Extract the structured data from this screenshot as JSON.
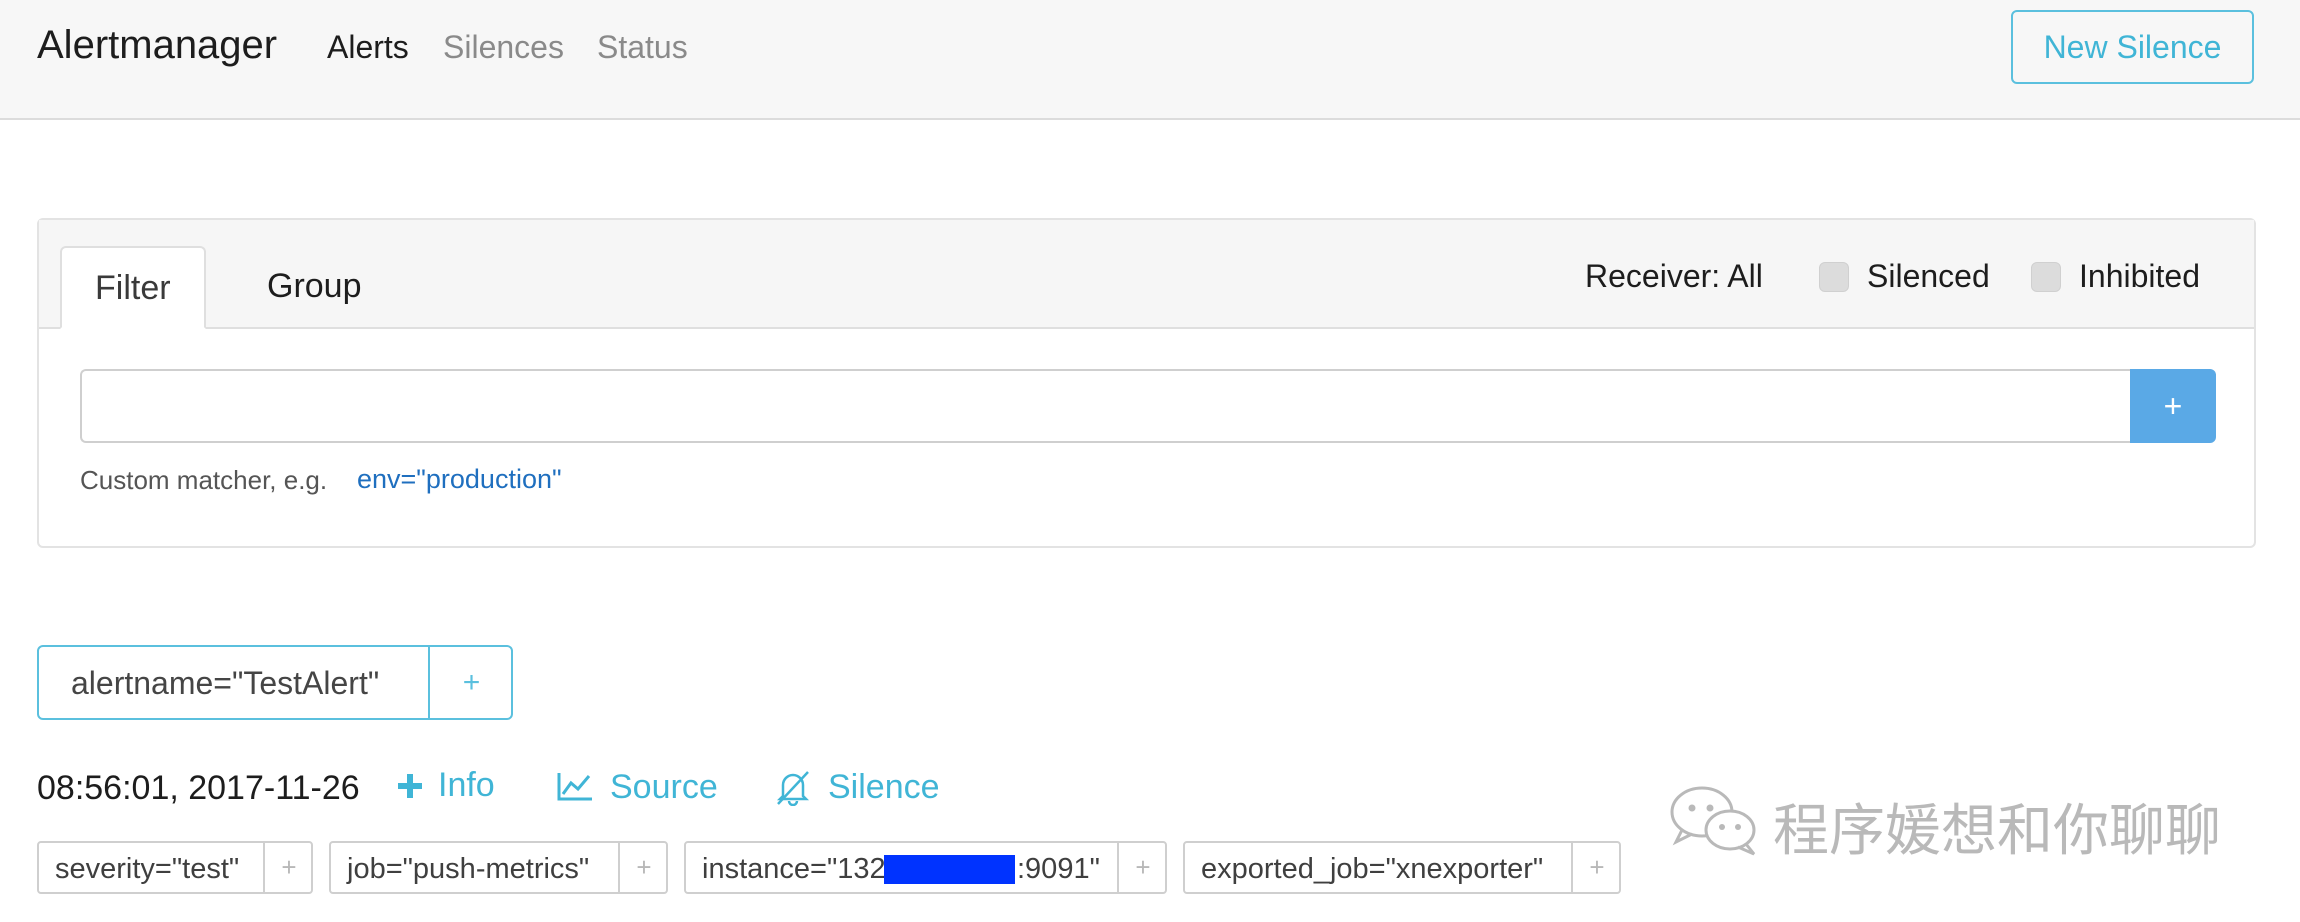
{
  "navbar": {
    "brand": "Alertmanager",
    "links": [
      "Alerts",
      "Silences",
      "Status"
    ],
    "new_silence_label": "New Silence"
  },
  "filter_card": {
    "tabs": [
      "Filter",
      "Group"
    ],
    "receiver_label": "Receiver: All",
    "silenced_label": "Silenced",
    "inhibited_label": "Inhibited",
    "input_value": "",
    "add_button_label": "+",
    "hint_text": "Custom matcher, e.g.",
    "hint_example": "env=\"production\""
  },
  "alert_group": {
    "group_label": "alertname=\"TestAlert\"",
    "plus_label": "+",
    "alert": {
      "timestamp": "08:56:01, 2017-11-26",
      "actions": {
        "info": "Info",
        "source": "Source",
        "silence": "Silence"
      },
      "labels": [
        "severity=\"test\"",
        "job=\"push-metrics\"",
        "instance=\"132",
        ":9091\"",
        "exported_job=\"xnexporter\""
      ],
      "label_plus": "+"
    }
  },
  "watermark": {
    "text": "程序媛想和你聊聊",
    "icon": "wechat-icon"
  },
  "colors": {
    "accent": "#5bc0de",
    "primary_button": "#5aa9e6",
    "redaction": "#0033ff"
  }
}
